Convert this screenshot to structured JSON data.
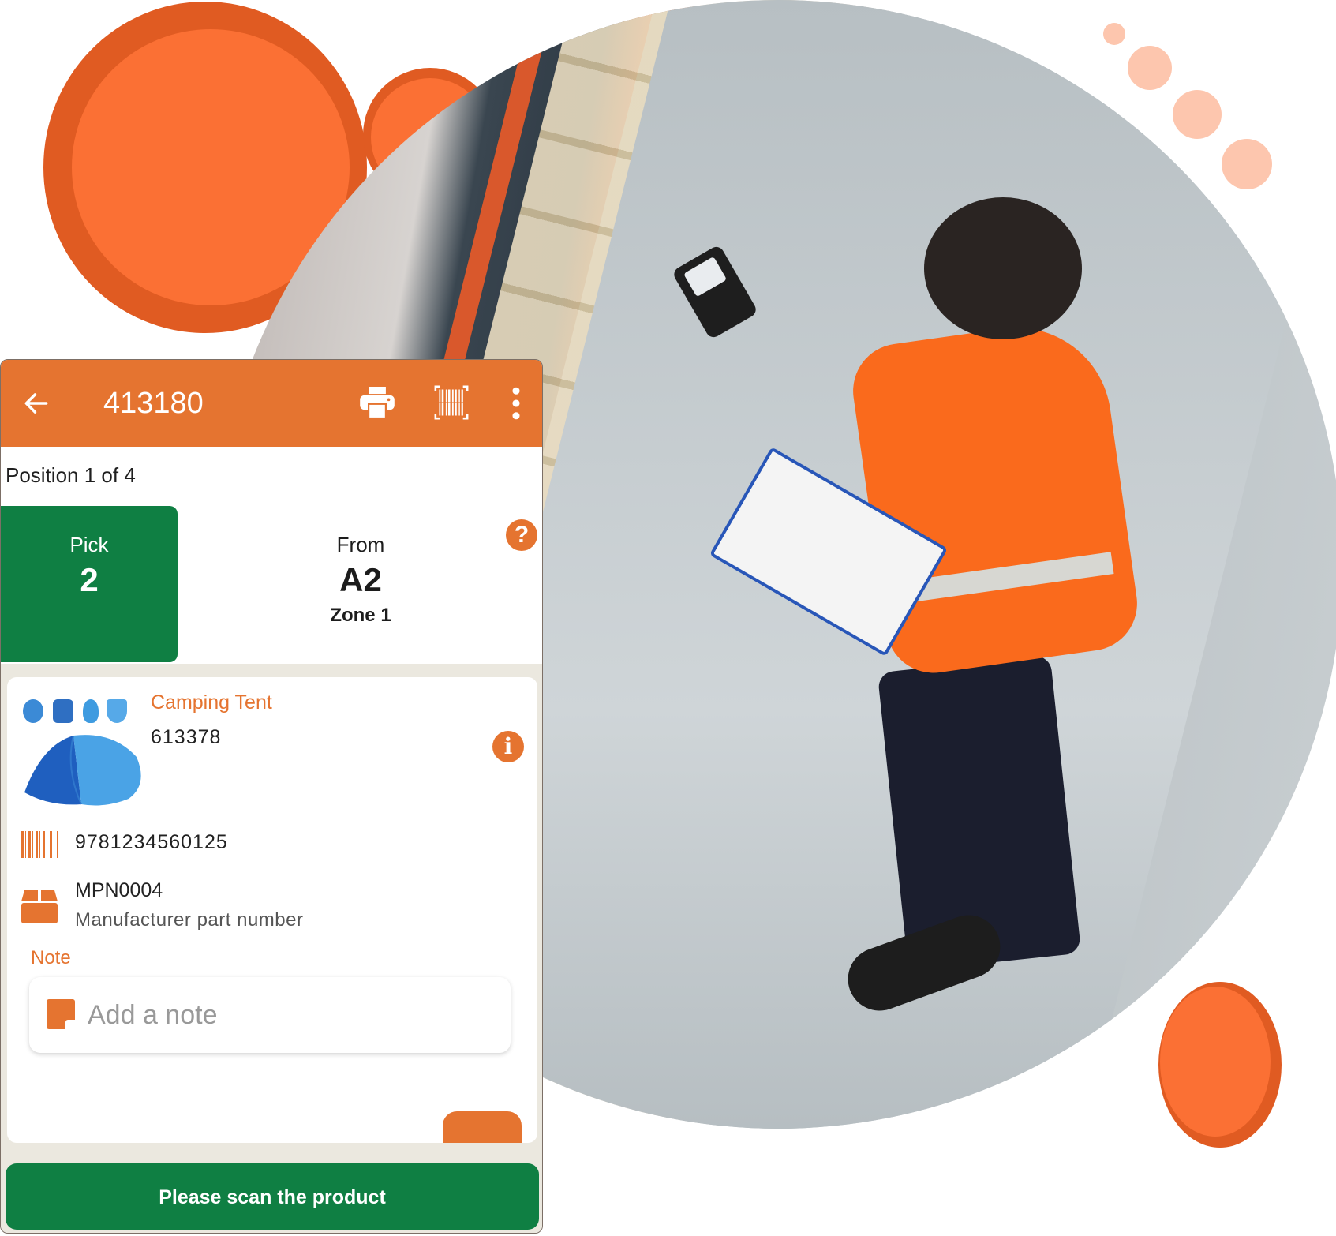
{
  "colors": {
    "brand_orange": "#e57430",
    "decor_orange": "#fb7034",
    "decor_orange_dark": "#e05b22",
    "decor_peach": "#fdc6ae",
    "success_green": "#0f7f43"
  },
  "appbar": {
    "title": "413180",
    "icons": [
      "back-arrow-icon",
      "printer-icon",
      "barcode-scan-icon",
      "more-vertical-icon"
    ]
  },
  "position": {
    "text": "Position 1 of 4"
  },
  "pick": {
    "label": "Pick",
    "quantity": "2"
  },
  "from": {
    "label": "From",
    "location": "A2",
    "zone": "Zone 1",
    "help_icon": "?"
  },
  "product": {
    "name": "Camping Tent",
    "sku": "613378",
    "info_icon": "i",
    "ean": "9781234560125",
    "mpn": "MPN0004",
    "mpn_label": "Manufacturer part number"
  },
  "note": {
    "label": "Note",
    "placeholder": "Add a note",
    "value": ""
  },
  "action": {
    "scan_label": "Please scan the product"
  }
}
